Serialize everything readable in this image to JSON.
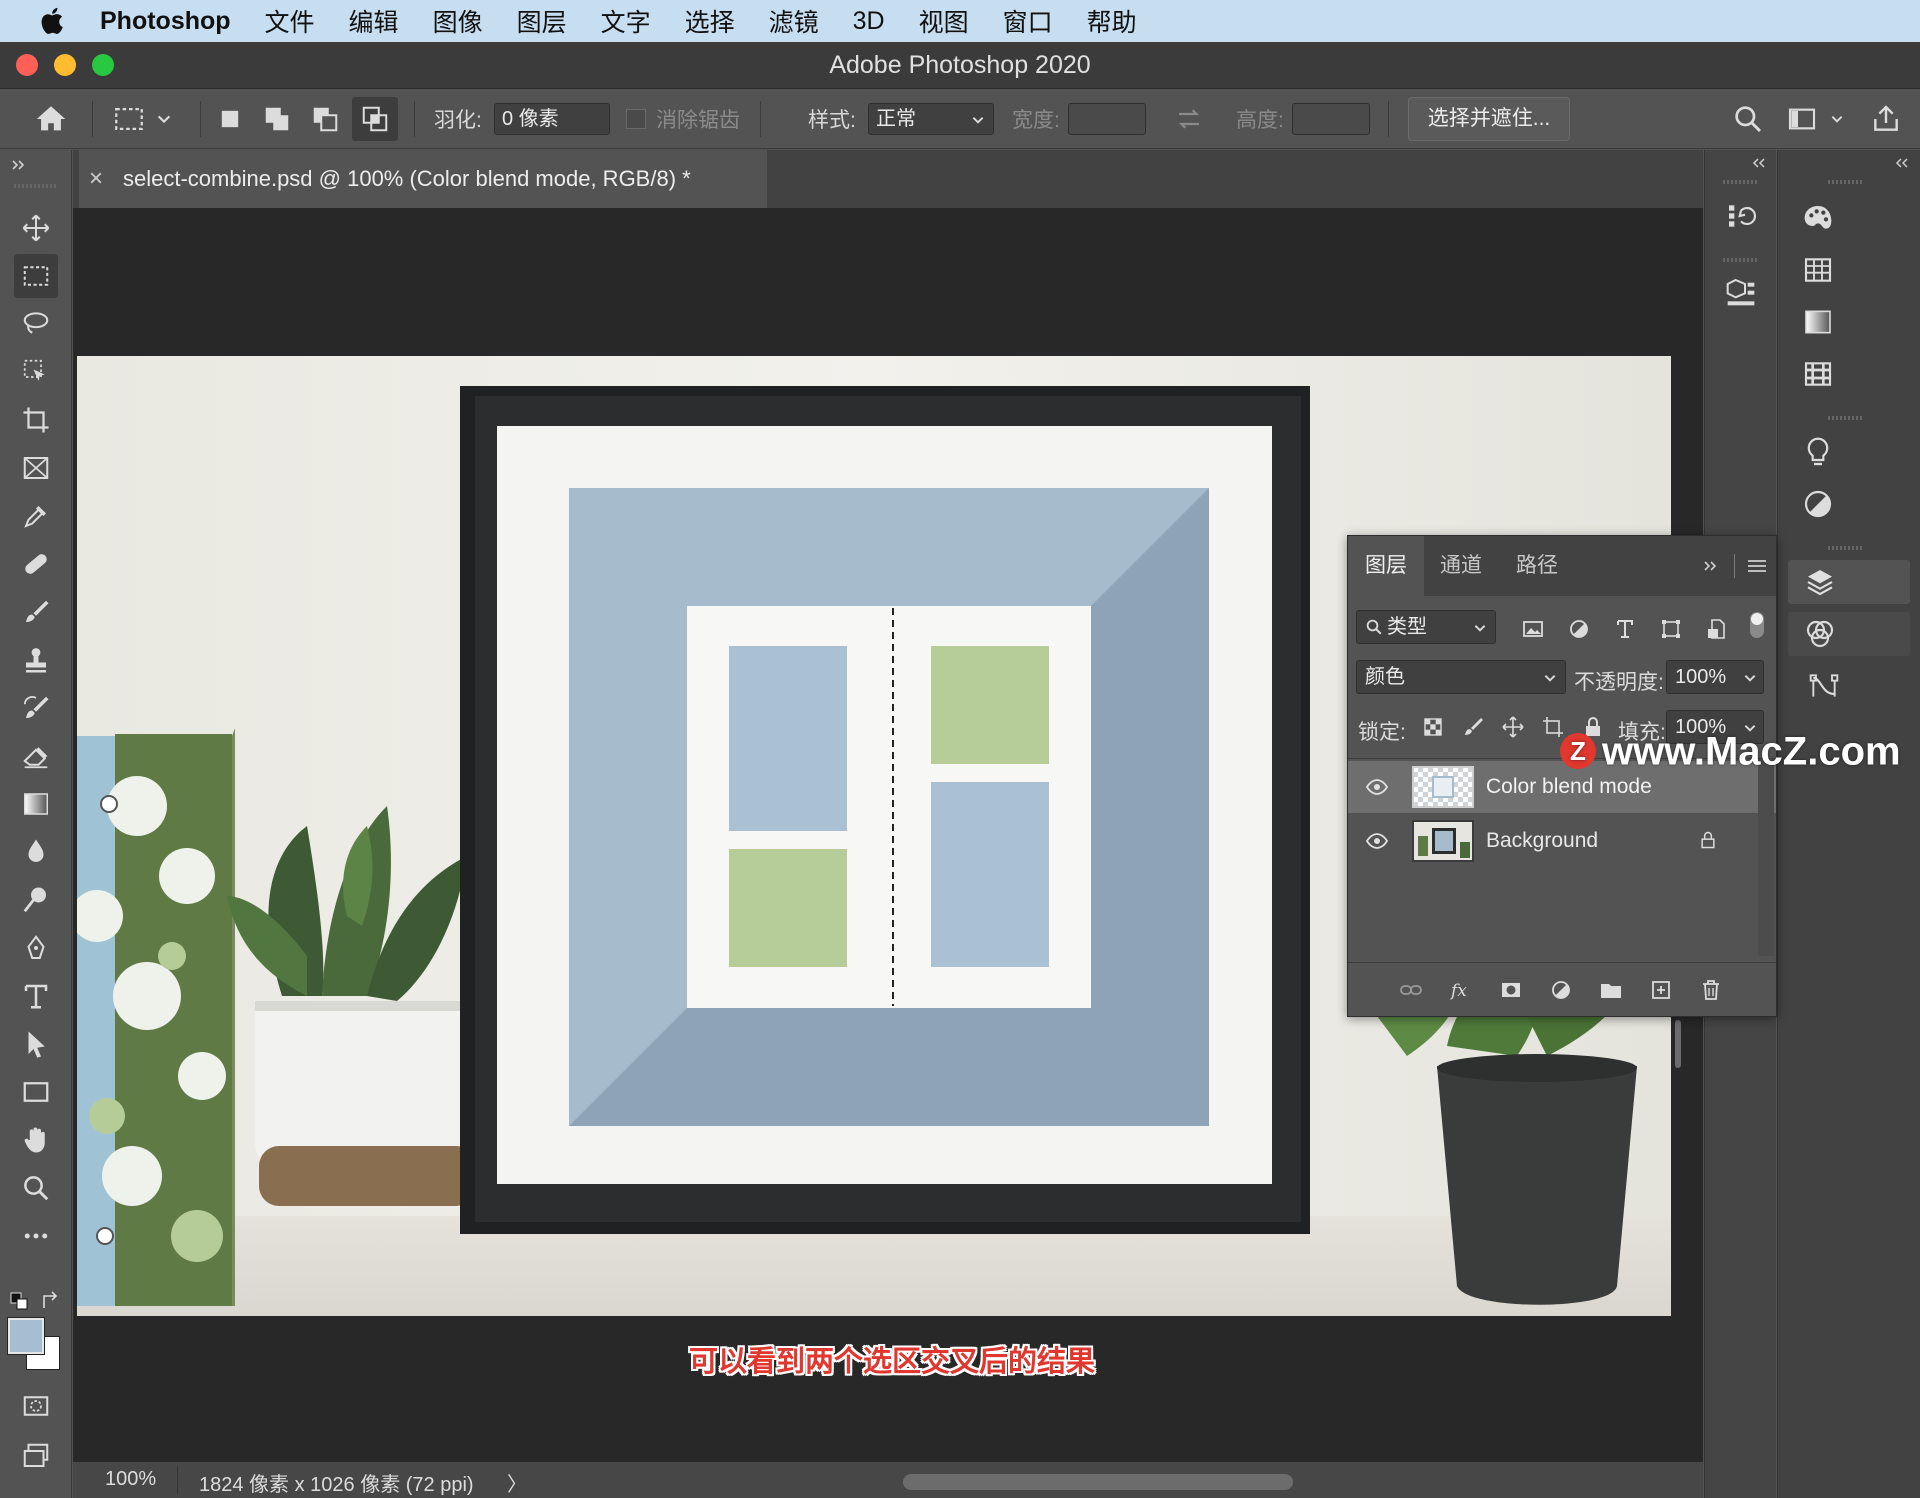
{
  "menubar": {
    "app": "Photoshop",
    "items": [
      "文件",
      "编辑",
      "图像",
      "图层",
      "文字",
      "选择",
      "滤镜",
      "3D",
      "视图",
      "窗口",
      "帮助"
    ]
  },
  "window": {
    "title": "Adobe Photoshop 2020"
  },
  "options": {
    "feather_label": "羽化:",
    "feather_value": "0 像素",
    "antialias_label": "消除锯齿",
    "style_label": "样式:",
    "style_value": "正常",
    "width_label": "宽度:",
    "height_label": "高度:",
    "select_mask_button": "选择并遮住..."
  },
  "document": {
    "tab_title": "select-combine.psd @ 100% (Color blend mode, RGB/8) *",
    "close_glyph": "×"
  },
  "status": {
    "zoom": "100%",
    "dimensions": "1824 像素 x 1026 像素 (72 ppi)",
    "arrow": "〉"
  },
  "layers_panel": {
    "tabs": [
      "图层",
      "通道",
      "路径"
    ],
    "filter_kind": "类型",
    "blend_mode": "颜色",
    "opacity_label": "不透明度:",
    "opacity_value": "100%",
    "lock_label": "锁定:",
    "fill_label": "填充:",
    "fill_value": "100%",
    "layers": [
      {
        "name": "Color blend mode",
        "selected": true
      },
      {
        "name": "Background",
        "locked": true
      }
    ]
  },
  "subtitle": "可以看到两个选区交叉后的结果",
  "watermark": "www.MacZ.com",
  "colors": {
    "accent_red": "#e0372e",
    "frame_blue": "#a3b7c8",
    "green": "#b6cc96",
    "panel_bg": "#535353"
  }
}
